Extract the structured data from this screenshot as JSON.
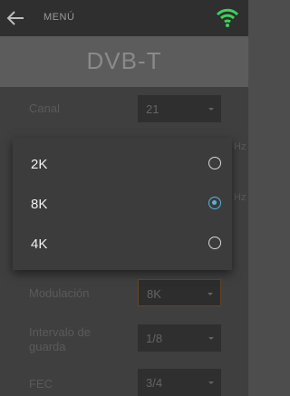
{
  "header": {
    "menu_label": "MENÚ",
    "title": "DVB-T"
  },
  "settings": [
    {
      "label": "Canal",
      "value": "21"
    },
    {
      "label": "Modulación",
      "value": "8K"
    },
    {
      "label": "Intervalo de guarda",
      "value": "1/8"
    },
    {
      "label": "FEC",
      "value": "3/4"
    }
  ],
  "units": [
    "Hz",
    "Hz"
  ],
  "dialog": {
    "options": [
      {
        "label": "2K",
        "selected": false
      },
      {
        "label": "8K",
        "selected": true
      },
      {
        "label": "4K",
        "selected": false
      }
    ]
  },
  "colors": {
    "accent": "#55b4d8",
    "wifi": "#3fd15b"
  },
  "icons": {
    "back": "arrow-left-icon",
    "signal": "wifi-icon"
  }
}
